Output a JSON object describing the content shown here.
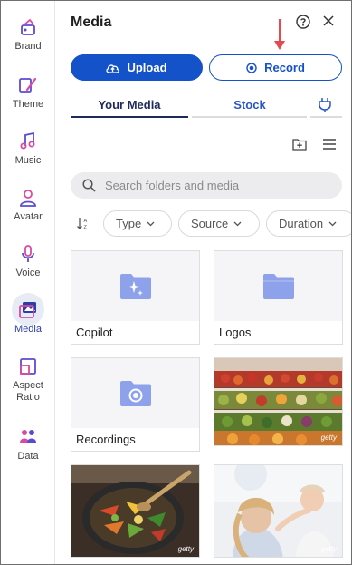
{
  "rail": [
    {
      "label": "Brand"
    },
    {
      "label": "Theme"
    },
    {
      "label": "Music"
    },
    {
      "label": "Avatar"
    },
    {
      "label": "Voice"
    },
    {
      "label": "Media"
    },
    {
      "label_line1": "Aspect",
      "label_line2": "Ratio"
    },
    {
      "label": "Data"
    }
  ],
  "header": {
    "title": "Media"
  },
  "actions": {
    "upload_label": "Upload",
    "record_label": "Record"
  },
  "tabs": [
    {
      "label": "Your Media"
    },
    {
      "label": "Stock"
    }
  ],
  "search": {
    "placeholder": "Search folders and media"
  },
  "filters": [
    {
      "label": "Type"
    },
    {
      "label": "Source"
    },
    {
      "label": "Duration"
    }
  ],
  "folders": [
    {
      "name": "Copilot"
    },
    {
      "name": "Logos"
    },
    {
      "name": "Recordings"
    }
  ],
  "photos": [
    {
      "watermark": "getty"
    },
    {
      "watermark": "getty"
    },
    {
      "watermark": "getty"
    }
  ],
  "colors": {
    "accent": "#1452c9",
    "folder": "#8ea2ec",
    "arrow": "#e5484d"
  }
}
